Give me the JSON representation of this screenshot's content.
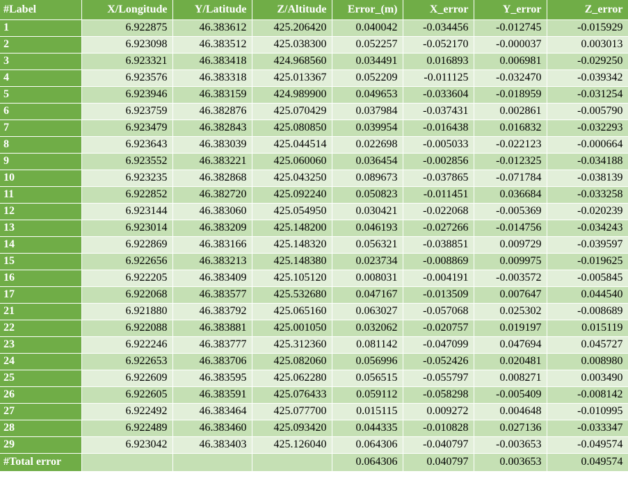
{
  "columns": [
    "#Label",
    "X/Longitude",
    "Y/Latitude",
    "Z/Altitude",
    "Error_(m)",
    "X_error",
    "Y_error",
    "Z_error"
  ],
  "rows": [
    [
      "1",
      "6.922875",
      "46.383612",
      "425.206420",
      "0.040042",
      "-0.034456",
      "-0.012745",
      "-0.015929"
    ],
    [
      "2",
      "6.923098",
      "46.383512",
      "425.038300",
      "0.052257",
      "-0.052170",
      "-0.000037",
      "0.003013"
    ],
    [
      "3",
      "6.923321",
      "46.383418",
      "424.968560",
      "0.034491",
      "0.016893",
      "0.006981",
      "-0.029250"
    ],
    [
      "4",
      "6.923576",
      "46.383318",
      "425.013367",
      "0.052209",
      "-0.011125",
      "-0.032470",
      "-0.039342"
    ],
    [
      "5",
      "6.923946",
      "46.383159",
      "424.989900",
      "0.049653",
      "-0.033604",
      "-0.018959",
      "-0.031254"
    ],
    [
      "6",
      "6.923759",
      "46.382876",
      "425.070429",
      "0.037984",
      "-0.037431",
      "0.002861",
      "-0.005790"
    ],
    [
      "7",
      "6.923479",
      "46.382843",
      "425.080850",
      "0.039954",
      "-0.016438",
      "0.016832",
      "-0.032293"
    ],
    [
      "8",
      "6.923643",
      "46.383039",
      "425.044514",
      "0.022698",
      "-0.005033",
      "-0.022123",
      "-0.000664"
    ],
    [
      "9",
      "6.923552",
      "46.383221",
      "425.060060",
      "0.036454",
      "-0.002856",
      "-0.012325",
      "-0.034188"
    ],
    [
      "10",
      "6.923235",
      "46.382868",
      "425.043250",
      "0.089673",
      "-0.037865",
      "-0.071784",
      "-0.038139"
    ],
    [
      "11",
      "6.922852",
      "46.382720",
      "425.092240",
      "0.050823",
      "-0.011451",
      "0.036684",
      "-0.033258"
    ],
    [
      "12",
      "6.923144",
      "46.383060",
      "425.054950",
      "0.030421",
      "-0.022068",
      "-0.005369",
      "-0.020239"
    ],
    [
      "13",
      "6.923014",
      "46.383209",
      "425.148200",
      "0.046193",
      "-0.027266",
      "-0.014756",
      "-0.034243"
    ],
    [
      "14",
      "6.922869",
      "46.383166",
      "425.148320",
      "0.056321",
      "-0.038851",
      "0.009729",
      "-0.039597"
    ],
    [
      "15",
      "6.922656",
      "46.383213",
      "425.148380",
      "0.023734",
      "-0.008869",
      "0.009975",
      "-0.019625"
    ],
    [
      "16",
      "6.922205",
      "46.383409",
      "425.105120",
      "0.008031",
      "-0.004191",
      "-0.003572",
      "-0.005845"
    ],
    [
      "17",
      "6.922068",
      "46.383577",
      "425.532680",
      "0.047167",
      "-0.013509",
      "0.007647",
      "0.044540"
    ],
    [
      "21",
      "6.921880",
      "46.383792",
      "425.065160",
      "0.063027",
      "-0.057068",
      "0.025302",
      "-0.008689"
    ],
    [
      "22",
      "6.922088",
      "46.383881",
      "425.001050",
      "0.032062",
      "-0.020757",
      "0.019197",
      "0.015119"
    ],
    [
      "23",
      "6.922246",
      "46.383777",
      "425.312360",
      "0.081142",
      "-0.047099",
      "0.047694",
      "0.045727"
    ],
    [
      "24",
      "6.922653",
      "46.383706",
      "425.082060",
      "0.056996",
      "-0.052426",
      "0.020481",
      "0.008980"
    ],
    [
      "25",
      "6.922609",
      "46.383595",
      "425.062280",
      "0.056515",
      "-0.055797",
      "0.008271",
      "0.003490"
    ],
    [
      "26",
      "6.922605",
      "46.383591",
      "425.076433",
      "0.059112",
      "-0.058298",
      "-0.005409",
      "-0.008142"
    ],
    [
      "27",
      "6.922492",
      "46.383464",
      "425.077700",
      "0.015115",
      "0.009272",
      "0.004648",
      "-0.010995"
    ],
    [
      "28",
      "6.922489",
      "46.383460",
      "425.093420",
      "0.044335",
      "-0.010828",
      "0.027136",
      "-0.033347"
    ],
    [
      "29",
      "6.923042",
      "46.383403",
      "425.126040",
      "0.064306",
      "-0.040797",
      "-0.003653",
      "-0.049574"
    ]
  ],
  "total": [
    "#Total error",
    "",
    "",
    "",
    "0.064306",
    "0.040797",
    "0.003653",
    "0.049574"
  ],
  "colors": {
    "header_green": "#70ad47",
    "band_dark": "#c5e0b4",
    "band_light": "#e2efd9",
    "header_text": "#ffffff"
  }
}
